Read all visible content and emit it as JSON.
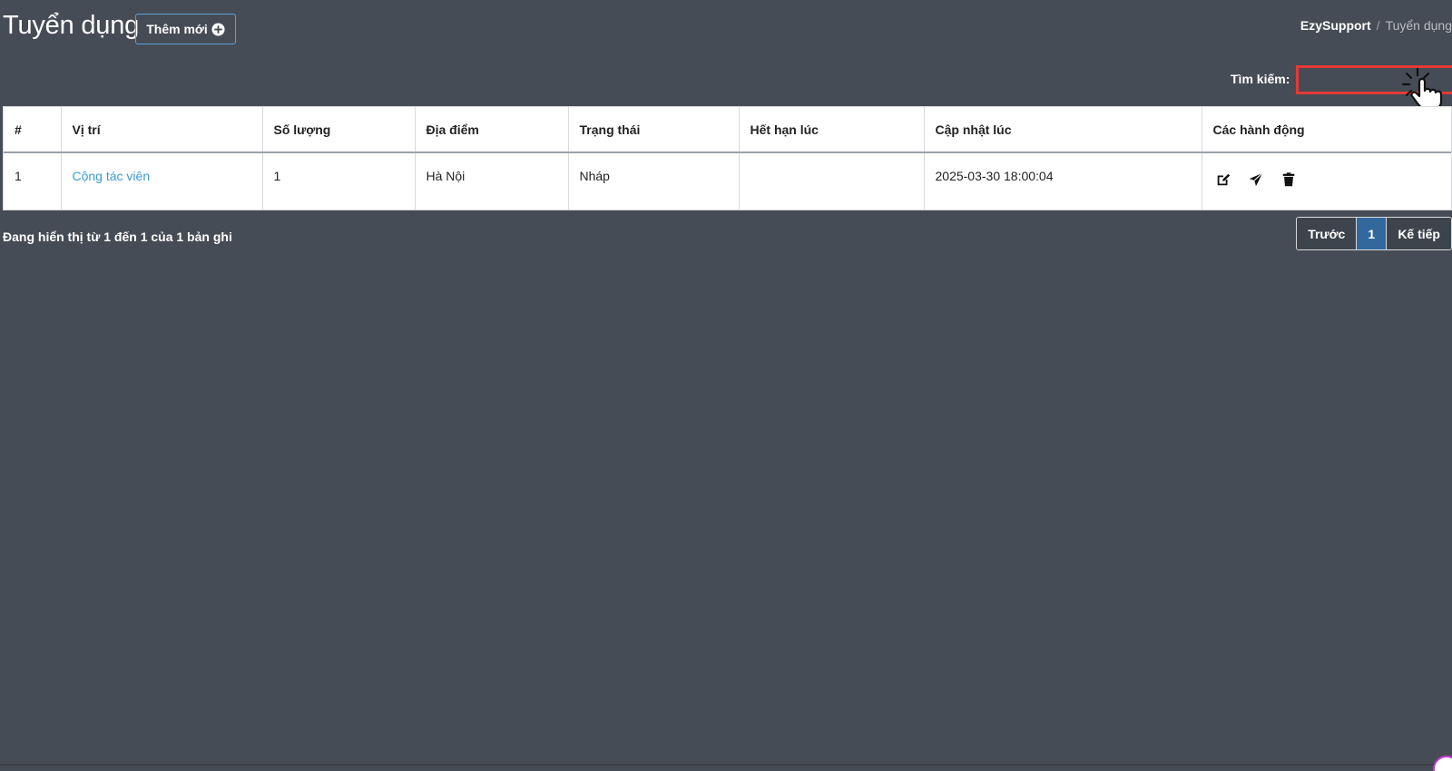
{
  "header": {
    "title": "Tuyển dụng",
    "add_button_label": "Thêm mới"
  },
  "breadcrumb": {
    "root": "EzySupport",
    "separator": "/",
    "current": "Tuyển dụng"
  },
  "search": {
    "label": "Tìm kiếm:",
    "value": ""
  },
  "table": {
    "columns": [
      "#",
      "Vị trí",
      "Số lượng",
      "Địa điểm",
      "Trạng thái",
      "Hết hạn lúc",
      "Cập nhật lúc",
      "Các hành động"
    ],
    "rows": [
      {
        "index": "1",
        "position": "Cộng tác viên",
        "quantity": "1",
        "location": "Hà Nội",
        "status": "Nháp",
        "expires_at": "",
        "updated_at": "2025-03-30 18:00:04",
        "actions": [
          "edit-icon",
          "send-icon",
          "trash-icon"
        ]
      }
    ]
  },
  "footer": {
    "info": "Đang hiển thị từ 1 đến 1 của 1 bản ghi",
    "prev_label": "Trước",
    "current_page": "1",
    "next_label": "Kế tiếp"
  },
  "colors": {
    "background": "#464c55",
    "accent": "#3a9ad9",
    "search_highlight": "#e53935",
    "active_page": "#32689c"
  }
}
